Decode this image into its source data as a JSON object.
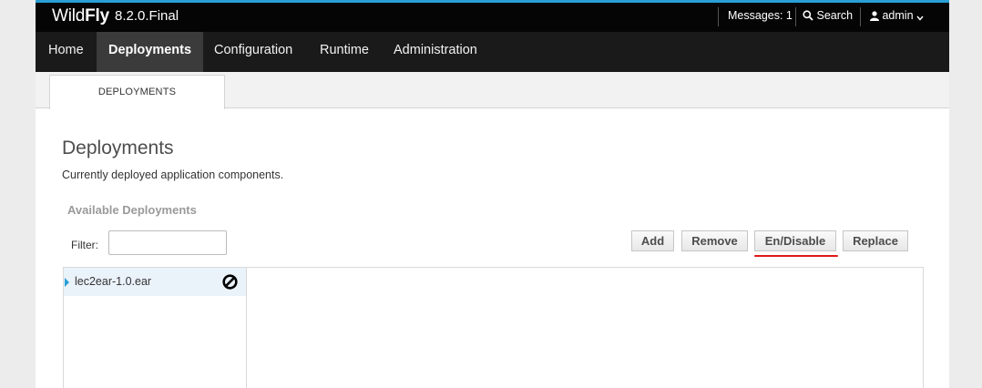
{
  "app": {
    "brand_wild": "Wild",
    "brand_fly": "Fly",
    "version": "8.2.0.Final"
  },
  "header": {
    "messages_label": "Messages: 1",
    "search_label": "Search",
    "user_label": "admin"
  },
  "nav": {
    "items": [
      {
        "label": "Home",
        "active": false
      },
      {
        "label": "Deployments",
        "active": true
      },
      {
        "label": "Configuration",
        "active": false
      },
      {
        "label": "Runtime",
        "active": false
      },
      {
        "label": "Administration",
        "active": false
      }
    ]
  },
  "subtab": {
    "label": "DEPLOYMENTS"
  },
  "page": {
    "title": "Deployments",
    "description": "Currently deployed application components."
  },
  "section": {
    "title": "Available Deployments"
  },
  "filter": {
    "label": "Filter:",
    "value": "",
    "placeholder": ""
  },
  "toolbar": {
    "add_label": "Add",
    "remove_label": "Remove",
    "endisable_label": "En/Disable",
    "replace_label": "Replace"
  },
  "deployments": [
    {
      "name": "lec2ear-1.0.ear",
      "status_icon": "disabled-icon"
    }
  ],
  "colors": {
    "accent": "#2a9fd6",
    "topbar_bg": "#050505",
    "navbar_bg": "#1a1a1a",
    "nav_active_bg": "#3b3b3b",
    "selected_row_bg": "#eaf2fa",
    "annotation_underline": "#e01818"
  }
}
